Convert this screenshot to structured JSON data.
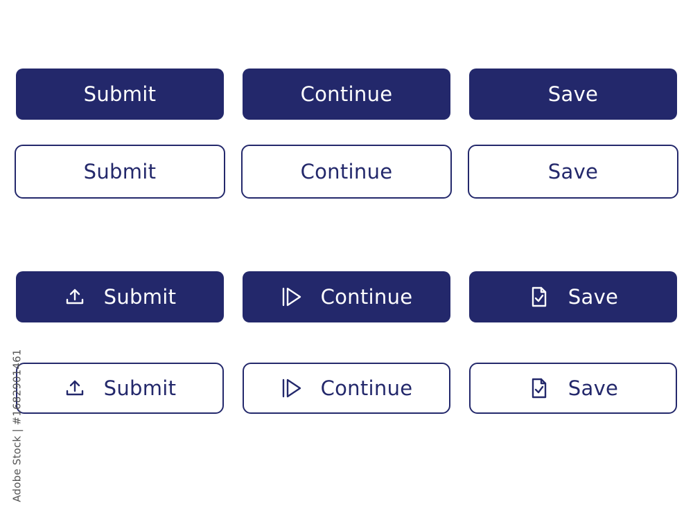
{
  "rows": [
    {
      "style": "filled",
      "buttons": [
        {
          "label": "Submit"
        },
        {
          "label": "Continue"
        },
        {
          "label": "Save"
        }
      ]
    },
    {
      "style": "outline",
      "buttons": [
        {
          "label": "Submit"
        },
        {
          "label": "Continue"
        },
        {
          "label": "Save"
        }
      ]
    },
    {
      "style": "filled-with-icon",
      "buttons": [
        {
          "label": "Submit",
          "icon": "upload-icon"
        },
        {
          "label": "Continue",
          "icon": "play-icon"
        },
        {
          "label": "Save",
          "icon": "document-check-icon"
        }
      ]
    },
    {
      "style": "outline-with-icon",
      "buttons": [
        {
          "label": "Submit",
          "icon": "upload-icon"
        },
        {
          "label": "Continue",
          "icon": "play-icon"
        },
        {
          "label": "Save",
          "icon": "document-check-icon"
        }
      ]
    }
  ],
  "colors": {
    "primary": "#23286b",
    "background": "#ffffff"
  },
  "watermark": {
    "text": "Adobe Stock | #1682901461"
  }
}
